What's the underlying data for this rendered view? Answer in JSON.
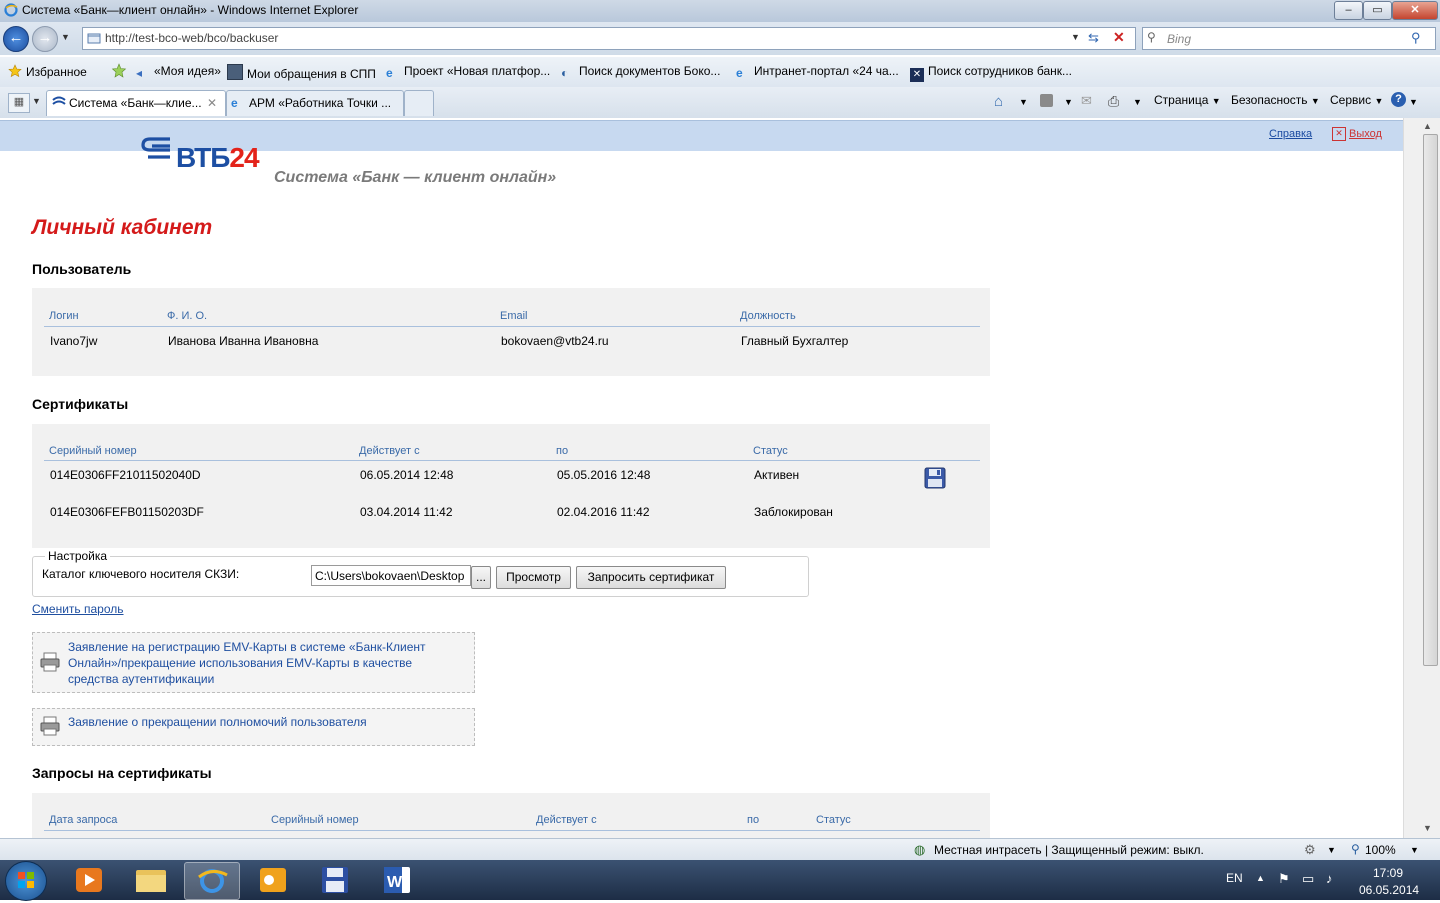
{
  "window": {
    "title": "Система «Банк—клиент онлайн» - Windows Internet Explorer",
    "min_label": "–",
    "max_label": "▭",
    "close_label": "✕"
  },
  "address_bar": {
    "url": "http://test-bco-web/bco/backuser",
    "search_placeholder": "Bing"
  },
  "favorites": {
    "label": "Избранное",
    "items": [
      "«Моя идея»",
      "Мои обращения в СПП",
      "Проект «Новая платфор...",
      "Поиск документов Боко...",
      "Интранет-портал «24 ча...",
      "Поиск сотрудников банк..."
    ]
  },
  "tabs": [
    "Система «Банк—клие...",
    "АРМ «Работника Точки ..."
  ],
  "command_bar": {
    "page": "Страница",
    "security": "Безопасность",
    "service": "Сервис"
  },
  "header": {
    "help": "Справка",
    "logout": "Выход",
    "logo_text": "ВТБ24",
    "system_name": "Система «Банк — клиент онлайн»"
  },
  "cabinet_title": "Личный кабинет",
  "user_section": {
    "title": "Пользователь",
    "columns": [
      "Логин",
      "Ф. И. О.",
      "Email",
      "Должность"
    ],
    "row": [
      "Ivano7jw",
      "Иванова Иванна Ивановна",
      "bokovaen@vtb24.ru",
      "Главный Бухгалтер"
    ]
  },
  "cert_section": {
    "title": "Сертификаты",
    "columns": [
      "Серийный номер",
      "Действует с",
      "по",
      "Статус"
    ],
    "rows": [
      [
        "014E0306FF21011502040D",
        "06.05.2014 12:48",
        "05.05.2016 12:48",
        "Активен"
      ],
      [
        "014E0306FEFB01150203DF",
        "03.04.2014 11:42",
        "02.04.2016 11:42",
        "Заблокирован"
      ]
    ]
  },
  "settings": {
    "legend": "Настройка",
    "catalog_label": "Каталог ключевого носителя СКЗИ:",
    "catalog_value": "C:\\Users\\bokovaen\\Desktop",
    "browse_label": "...",
    "view_button": "Просмотр",
    "request_button": "Запросить сертификат"
  },
  "change_password": "Сменить пароль",
  "documents": [
    "Заявление на регистрацию EMV-Карты в системе «Банк-Клиент Онлайн»/прекращение использования EMV-Карты в качестве средства аутентификации",
    "Заявление о прекращении полномочий пользователя"
  ],
  "requests_section": {
    "title": "Запросы на сертификаты",
    "columns": [
      "Дата запроса",
      "Серийный номер",
      "Действует с",
      "по",
      "Статус"
    ]
  },
  "statusbar": {
    "zone": "Местная интрасеть | Защищенный режим: выкл.",
    "zoom": "100%"
  },
  "taskbar": {
    "lang": "EN",
    "time": "17:09",
    "date": "06.05.2014"
  },
  "colors": {
    "brand_blue": "#1d4fa3",
    "brand_red": "#e3231a",
    "title_red": "#d41a1a"
  }
}
